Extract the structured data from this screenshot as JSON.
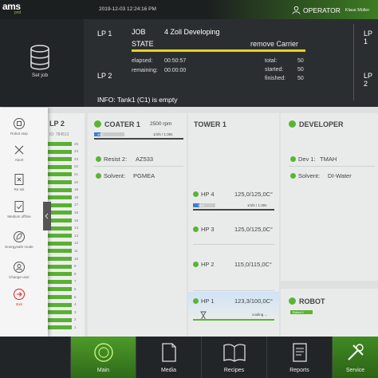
{
  "topbar": {
    "logo": "ams",
    "logo_sub": "pnd",
    "datetime": "2019-12-03 12:24:16 PM",
    "user_role": "OPERATOR",
    "user_name": "Klaus Müller",
    "user_icon": "user-icon"
  },
  "header": {
    "set_job_label": "Set job",
    "lp1": "LP 1",
    "lp2": "LP 2",
    "job_key": "JOB",
    "job_value": "4 Zoll Developing",
    "state_key": "STATE",
    "state_value": "remove Carrier",
    "elapsed_key": "elapsed:",
    "elapsed_value": "00:50:57",
    "remaining_key": "remaining:",
    "remaining_value": "00:00:00",
    "total_key": "total:",
    "total_value": "50",
    "started_key": "started:",
    "started_value": "50",
    "finished_key": "finished:",
    "finished_value": "50",
    "info": "INFO: Tank1 (C1) is empty",
    "right_lp1": "LP 1",
    "right_lp2": "LP 2"
  },
  "side_menu": {
    "items": [
      {
        "label": "Robot stop",
        "icon": "robot-stop-icon"
      },
      {
        "label": "Abort",
        "icon": "abort-x-icon"
      },
      {
        "label": "Re init",
        "icon": "reinit-icon"
      },
      {
        "label": "Medium offline",
        "icon": "medium-offline-icon"
      },
      {
        "label": "Energysafe mode",
        "icon": "leaf-icon"
      },
      {
        "label": "Change user",
        "icon": "change-user-icon"
      },
      {
        "label": "Exit",
        "icon": "exit-icon"
      }
    ]
  },
  "lp2_column": {
    "title": "LP 2",
    "carrier_id": "ID: 784513",
    "slot_numbers": [
      "25",
      "24",
      "23",
      "22",
      "21",
      "20",
      "19",
      "18",
      "17",
      "16",
      "15",
      "14",
      "13",
      "12",
      "11",
      "10",
      "9",
      "8",
      "7",
      "6",
      "5",
      "4",
      "3",
      "2",
      "1"
    ]
  },
  "coater": {
    "title": "COATER 1",
    "rpm": "2500 rpm",
    "progress_label": "48/0",
    "progress_fraction": 0.22,
    "time_label": "1/1fs / 1:30s",
    "resist_label": "Resist 2:",
    "resist_value": "AZ533",
    "solvent_label": "Solvent:",
    "solvent_value": "PGMEA"
  },
  "tower": {
    "title": "TOWER 1",
    "hotplates": [
      {
        "name": "HP 4",
        "temp": "125,0/125,0C°",
        "progress_label": "34/0",
        "progress_fraction": 0.28,
        "time_label": "1/1fs / 1:30s"
      },
      {
        "name": "HP 3",
        "temp": "125,0/125,0C°"
      },
      {
        "name": "HP 2",
        "temp": "115,0/115,0C°"
      },
      {
        "name": "HP 1",
        "temp": "123,3/100,0C°",
        "status": "cooling ..."
      }
    ]
  },
  "developer": {
    "title": "DEVELOPER",
    "dev_label": "Dev 1:",
    "dev_value": "TMAH",
    "solvent_label": "Solvent:",
    "solvent_value": "DI-Water"
  },
  "robot": {
    "title": "ROBOT",
    "badge": "Robot 1"
  },
  "bottom_nav": {
    "items": [
      {
        "label": "Main",
        "icon": "main-icon"
      },
      {
        "label": "Media",
        "icon": "media-icon"
      },
      {
        "label": "Recipes",
        "icon": "recipes-book-icon"
      },
      {
        "label": "Reports",
        "icon": "reports-icon"
      },
      {
        "label": "Service",
        "icon": "service-tools-icon"
      }
    ]
  },
  "colors": {
    "accent_green": "#5ab534",
    "state_yellow": "#e8d21c",
    "progress_blue": "#3a7ed3",
    "dark_bg": "#2b2e30"
  }
}
